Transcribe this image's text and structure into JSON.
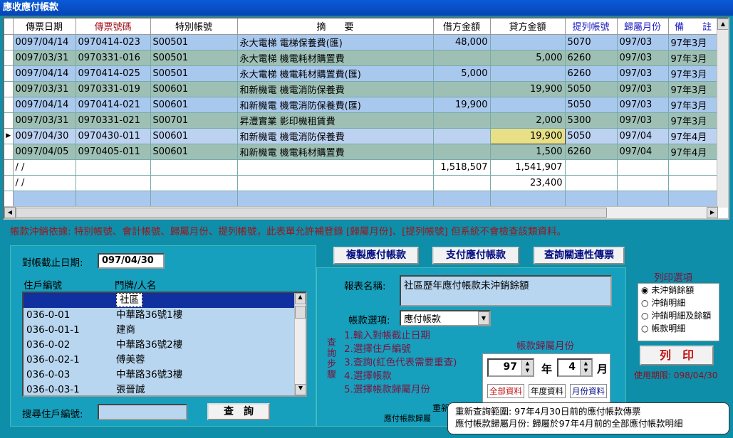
{
  "window_title": "應收應付帳款",
  "grid": {
    "headers": [
      "傳票日期",
      "傳票號碼",
      "特別帳號",
      "摘　　要",
      "借方金額",
      "貸方金額",
      "提列帳號",
      "歸屬月份",
      "備　　註"
    ],
    "rows": [
      {
        "style": "blue",
        "date": "0097/04/14",
        "voucher": "0970414-023",
        "account": "S00501",
        "summary": "永大電梯 電梯保養費(匯)",
        "debit": "48,000",
        "credit": "",
        "accrual": "5070",
        "month": "097/03",
        "note": "97年3月"
      },
      {
        "style": "green",
        "date": "0097/03/31",
        "voucher": "0970331-016",
        "account": "S00501",
        "summary": "永大電梯 機電耗材購置費",
        "debit": "",
        "credit": "5,000",
        "accrual": "6260",
        "month": "097/03",
        "note": "97年3月"
      },
      {
        "style": "blue",
        "date": "0097/04/14",
        "voucher": "0970414-025",
        "account": "S00501",
        "summary": "永大電梯 機電耗材購置費(匯)",
        "debit": "5,000",
        "credit": "",
        "accrual": "6260",
        "month": "097/03",
        "note": "97年3月"
      },
      {
        "style": "green",
        "date": "0097/03/31",
        "voucher": "0970331-019",
        "account": "S00601",
        "summary": "和新機電 機電消防保養費",
        "debit": "",
        "credit": "19,900",
        "accrual": "5050",
        "month": "097/03",
        "note": "97年3月"
      },
      {
        "style": "blue",
        "date": "0097/04/14",
        "voucher": "0970414-021",
        "account": "S00601",
        "summary": "和新機電 機電消防保養費(匯)",
        "debit": "19,900",
        "credit": "",
        "accrual": "5050",
        "month": "097/03",
        "note": "97年3月"
      },
      {
        "style": "green",
        "date": "0097/03/31",
        "voucher": "0970331-021",
        "account": "S00701",
        "summary": "昇灃實業 影印機租賃費",
        "debit": "",
        "credit": "2,000",
        "accrual": "5300",
        "month": "097/03",
        "note": "97年3月"
      },
      {
        "style": "cur",
        "date": "0097/04/30",
        "voucher": "0970430-011",
        "account": "S00601",
        "summary": "和新機電 機電消防保養費",
        "debit": "",
        "credit": "19,900",
        "accrual": "5050",
        "month": "097/04",
        "note": "97年4月"
      },
      {
        "style": "green",
        "date": "0097/04/05",
        "voucher": "0970405-011",
        "account": "S00601",
        "summary": "和新機電 機電耗材購置費",
        "debit": "",
        "credit": "1,500",
        "accrual": "6260",
        "month": "097/04",
        "note": "97年4月"
      },
      {
        "style": "white",
        "date": " /  /",
        "voucher": "",
        "account": "",
        "summary": "",
        "debit": "1,518,507",
        "credit": "1,541,907",
        "accrual": "",
        "month": "",
        "note": ""
      },
      {
        "style": "white",
        "date": " /  /",
        "voucher": "",
        "account": "",
        "summary": "",
        "debit": "",
        "credit": "23,400",
        "accrual": "",
        "month": "",
        "note": ""
      },
      {
        "style": "blue",
        "date": "",
        "voucher": "",
        "account": "",
        "summary": "",
        "debit": "",
        "credit": "",
        "accrual": "",
        "month": "",
        "note": ""
      }
    ]
  },
  "note_text": "帳款沖銷依據: 特別帳號、會計帳號、歸屬月份、提列帳號，此表單允許補登錄 [歸屬月份]、[提列帳號] 但系統不會檢查該類資料。",
  "left": {
    "cutoff_label": "對帳截止日期:",
    "cutoff_value": "097/04/30",
    "col1": "住戶編號",
    "col2": "門牌/人名",
    "list": [
      {
        "id": "",
        "name": "社區"
      },
      {
        "id": "036-0-01",
        "name": "中華路36號1樓"
      },
      {
        "id": "036-0-01-1",
        "name": "建商"
      },
      {
        "id": "036-0-02",
        "name": "中華路36號2樓"
      },
      {
        "id": "036-0-02-1",
        "name": "傅美蓉"
      },
      {
        "id": "036-0-03",
        "name": "中華路36號3樓"
      },
      {
        "id": "036-0-03-1",
        "name": "張晉誠"
      }
    ],
    "search_label": "搜尋住戶編號:",
    "search_value": "",
    "query_btn": "查　詢"
  },
  "top_buttons": {
    "copy": "複製應付帳款",
    "pay": "支付應付帳款",
    "lookup": "查詢關連性傳票"
  },
  "right": {
    "report_label": "報表名稱:",
    "report_value": "社區歷年應付帳款未沖銷餘額",
    "option_label": "帳款選項:",
    "option_value": "應付帳款",
    "steps_vertical": "查詢步驟",
    "steps": [
      "1.輸入對帳截止日期",
      "2.選擇住戶編號",
      "3.查詢(紅色代表需要重查)",
      "4.選擇帳款",
      "5.選擇帳款歸屬月份"
    ],
    "month_title": "帳款歸屬月份",
    "year": "97",
    "year_unit": "年",
    "month": "4",
    "month_unit": "月",
    "tab_all": "全部資料",
    "tab_year": "年度資料",
    "tab_month": "月份資料",
    "bottom_text": "重新",
    "bottom_text2": "應付帳款歸屬"
  },
  "print": {
    "title": "列印選項",
    "options": [
      "未沖銷餘額",
      "沖銷明細",
      "沖銷明細及餘額",
      "帳款明細"
    ],
    "selected": 0,
    "button": "列　印",
    "expiry": "使用期限: 098/04/30"
  },
  "tooltip": {
    "line1": "重新查詢範圍: 97年4月30日前的應付帳款傳票",
    "line2": "應付帳款歸屬月份: 歸屬於97年4月前的全部應付帳款明細"
  }
}
